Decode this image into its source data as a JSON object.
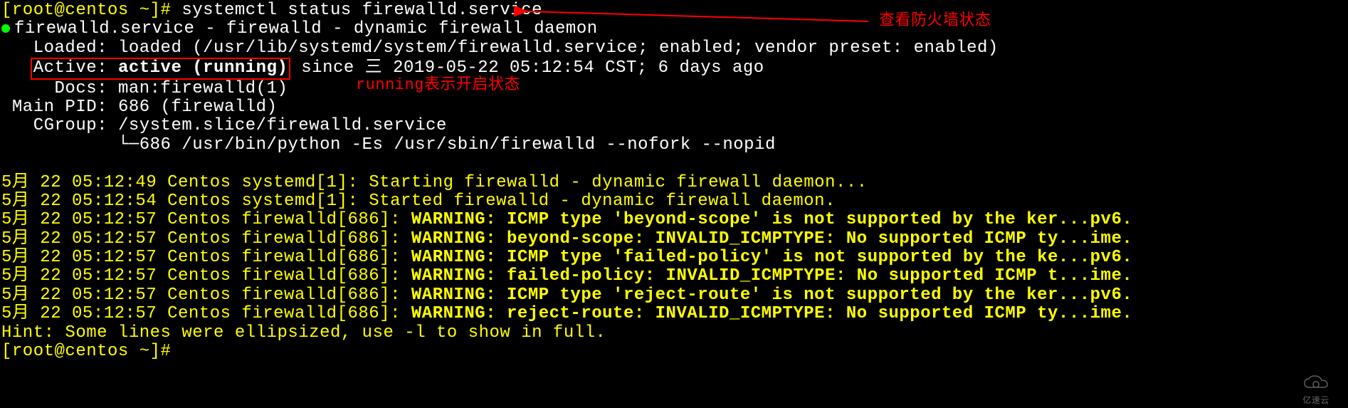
{
  "prompt1_user": "[root@centos ~]",
  "prompt1_hash": "# ",
  "cmd1": "systemctl status firewalld.service",
  "annotation_arrow_label": "查看防火墙状态",
  "unit_header": "firewalld.service - firewalld - dynamic firewall daemon",
  "loaded_label": "   Loaded: ",
  "loaded_value": "loaded (/usr/lib/systemd/system/firewalld.service; enabled; vendor preset: enabled)",
  "active_label": "Active: ",
  "active_value": "active (running)",
  "active_since": " since 三 2019-05-22 05:12:54 CST; 6 days ago",
  "running_note": "running表示开启状态",
  "docs_label": "     Docs: ",
  "docs_value": "man:firewalld(1)",
  "mainpid_label": " Main PID: ",
  "mainpid_value": "686 (firewalld)",
  "cgroup_label": "   CGroup: ",
  "cgroup_value": "/system.slice/firewalld.service",
  "cgroup_tree": "           └─686 /usr/bin/python -Es /usr/sbin/firewalld --nofork --nopid",
  "log1_prefix": "5月 22 05:12:49 Centos systemd[1]: ",
  "log1_msg": "Starting firewalld - dynamic firewall daemon...",
  "log2_prefix": "5月 22 05:12:54 Centos systemd[1]: ",
  "log2_msg": "Started firewalld - dynamic firewall daemon.",
  "log3_prefix": "5月 22 05:12:57 Centos firewalld[686]: ",
  "log3_msg": "WARNING: ICMP type 'beyond-scope' is not supported by the ker...pv6.",
  "log4_prefix": "5月 22 05:12:57 Centos firewalld[686]: ",
  "log4_msg": "WARNING: beyond-scope: INVALID_ICMPTYPE: No supported ICMP ty...ime.",
  "log5_prefix": "5月 22 05:12:57 Centos firewalld[686]: ",
  "log5_msg": "WARNING: ICMP type 'failed-policy' is not supported by the ke...pv6.",
  "log6_prefix": "5月 22 05:12:57 Centos firewalld[686]: ",
  "log6_msg": "WARNING: failed-policy: INVALID_ICMPTYPE: No supported ICMP t...ime.",
  "log7_prefix": "5月 22 05:12:57 Centos firewalld[686]: ",
  "log7_msg": "WARNING: ICMP type 'reject-route' is not supported by the ker...pv6.",
  "log8_prefix": "5月 22 05:12:57 Centos firewalld[686]: ",
  "log8_msg": "WARNING: reject-route: INVALID_ICMPTYPE: No supported ICMP ty...ime.",
  "hint": "Hint: Some lines were ellipsized, use -l to show in full.",
  "prompt2_user": "[root@centos ~]",
  "prompt2_hash": "#",
  "watermark": "亿速云"
}
